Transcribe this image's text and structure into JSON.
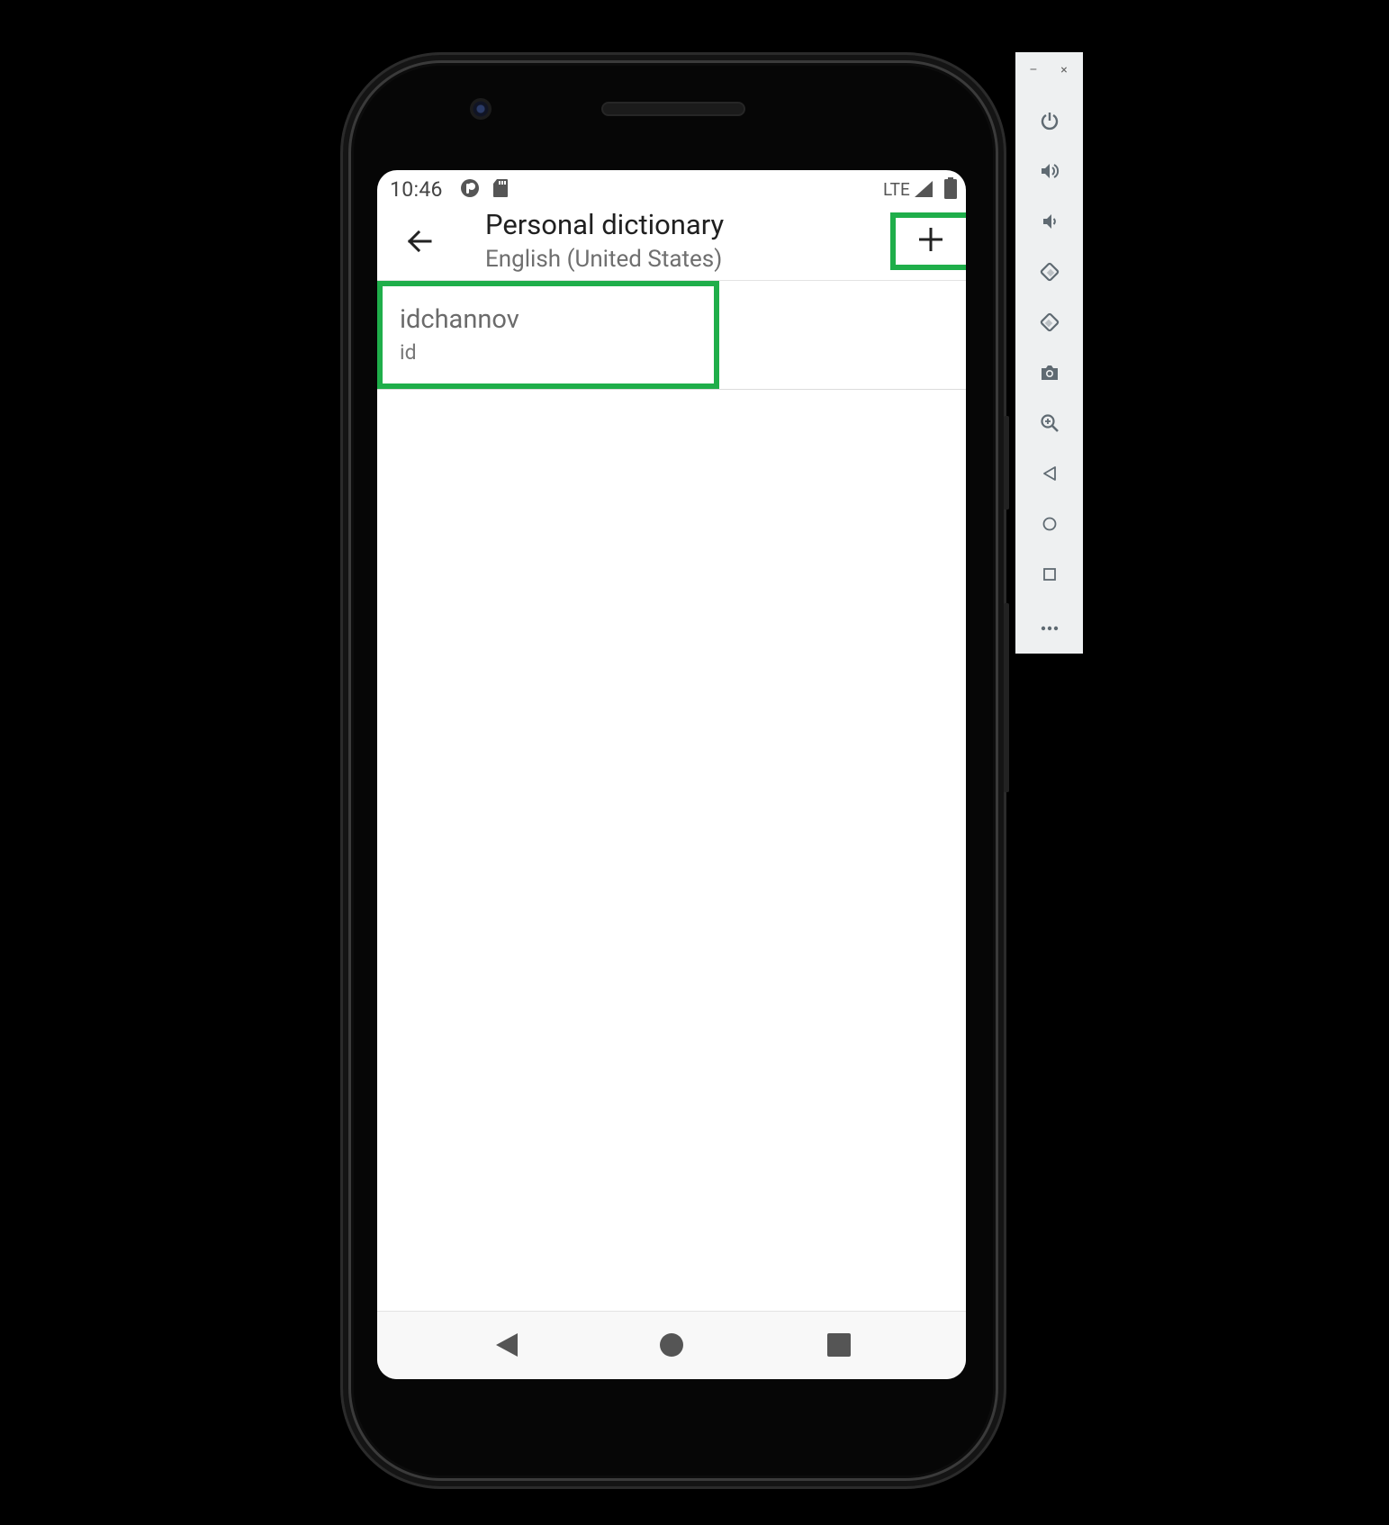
{
  "status_bar": {
    "time": "10:46",
    "network": "LTE",
    "icons": [
      "app-notification-icon",
      "sd-card-icon",
      "signal-icon",
      "battery-icon"
    ]
  },
  "app_bar": {
    "title": "Personal dictionary",
    "subtitle": "English (United States)",
    "back_icon": "arrow-left-icon",
    "add_icon": "plus-icon"
  },
  "words": [
    {
      "word": "idchannov",
      "shortcut": "id"
    }
  ],
  "nav_bar": {
    "icons": [
      "back-triangle-icon",
      "home-circle-icon",
      "recents-square-icon"
    ]
  },
  "emulator_toolbar": {
    "window_controls": [
      "minimize-icon",
      "close-icon"
    ],
    "minimize_glyph": "–",
    "close_glyph": "×",
    "buttons": [
      "power-icon",
      "volume-up-icon",
      "volume-down-icon",
      "rotate-left-icon",
      "rotate-right-icon",
      "camera-icon",
      "zoom-icon",
      "back-icon",
      "home-icon",
      "overview-icon",
      "more-icon"
    ]
  },
  "colors": {
    "highlight": "#1fae4a",
    "toolbar_icon": "#5f6a72",
    "title_text": "#202020",
    "subtitle_text": "#6f6f6f"
  }
}
